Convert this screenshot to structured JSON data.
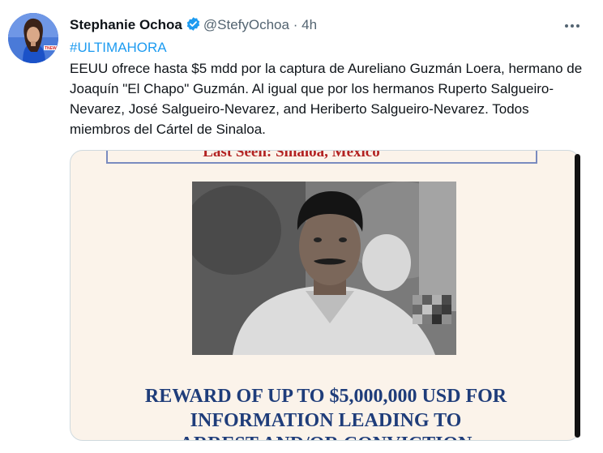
{
  "author": {
    "name": "Stephanie Ochoa",
    "handle": "@StefyOchoa",
    "separator": "·",
    "time": "4h"
  },
  "tweet": {
    "hashtag": "#ULTIMAHORA",
    "text": "EEUU ofrece hasta $5 mdd por la captura de Aureliano Guzmán Loera, hermano de Joaquín \"El Chapo\" Guzmán. Al igual que por los hermanos Ruperto Salgueiro-Nevarez, José Salgueiro-Nevarez, and Heriberto Salgueiro-Nevarez. Todos miembros del Cártel de Sinaloa."
  },
  "poster": {
    "last_seen": "Last Seen: Sinaloa, Mexico",
    "reward_line1": "REWARD OF UP TO $5,000,000 USD FOR",
    "reward_line2": "INFORMATION LEADING TO",
    "reward_line3": "ARREST AND/OR CONVICTION"
  },
  "icons": {
    "verified": "verified-badge-icon",
    "more": "more-options-icon"
  },
  "colors": {
    "accent": "#1d9bf0",
    "text": "#0f1419",
    "muted": "#536471",
    "poster_red": "#b22222",
    "poster_blue": "#1f3d7a"
  }
}
